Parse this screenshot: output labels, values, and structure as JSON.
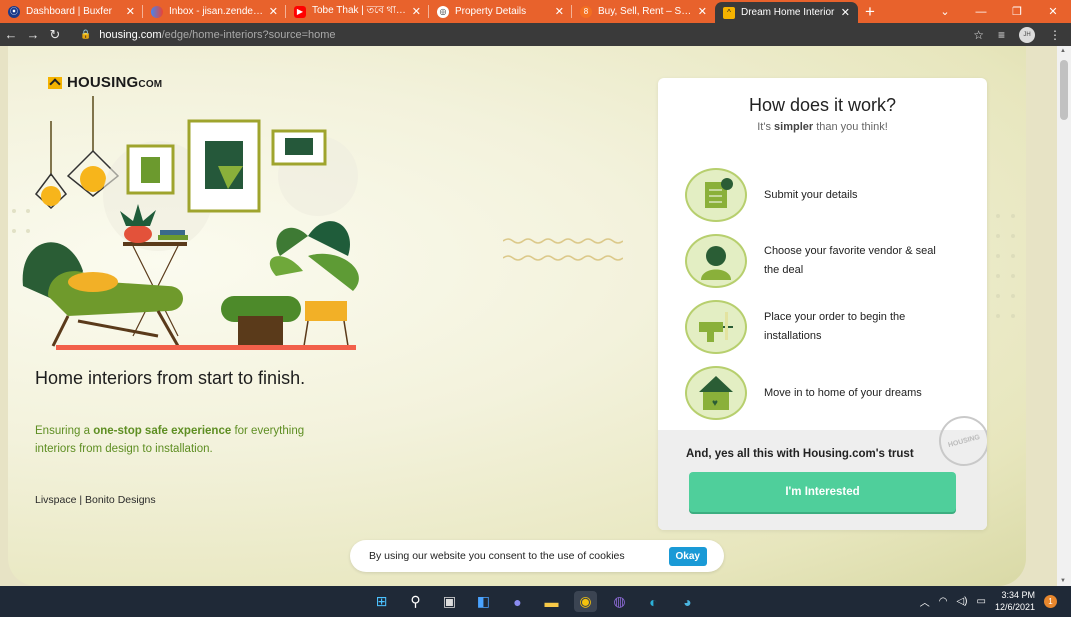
{
  "browser": {
    "tabs": [
      {
        "title": "Dashboard | Buxfer",
        "favicon_color": "#1b3a8a"
      },
      {
        "title": "Inbox - jisan.zendesign",
        "favicon_color": "#8e44ad"
      },
      {
        "title": "Tobe Thak | তবে থাক |",
        "favicon_color": "#ff0000"
      },
      {
        "title": "Property Details",
        "favicon_color": "#2c2c2c"
      },
      {
        "title": "Buy, Sell, Rent – SG Co",
        "favicon_color": "#f36f21"
      },
      {
        "title": "Dream Home Interior",
        "favicon_color": "#f5b300"
      }
    ],
    "new_tab_label": "+",
    "url_host": "housing.com",
    "url_path": "/edge/home-interiors?source=home",
    "profile_label": "JH"
  },
  "page": {
    "logo_word": "HOUSING",
    "logo_suffix": "COM",
    "hero_title": "Home interiors from start to finish.",
    "hero_sub_pre": "Ensuring a ",
    "hero_sub_bold": "one-stop safe experience",
    "hero_sub_post": " for everything interiors from design to installation.",
    "partners": "Livspace | Bonito Designs",
    "card": {
      "title": "How does it work?",
      "tag_pre": "It's ",
      "tag_bold": "simpler",
      "tag_post": " than you think!",
      "steps": [
        {
          "text": "Submit your details",
          "icon": "form-icon"
        },
        {
          "text": "Choose your favorite vendor & seal the deal",
          "icon": "vendor-icon"
        },
        {
          "text": "Place your order to begin the installations",
          "icon": "drill-icon"
        },
        {
          "text": "Move in to home of your dreams",
          "icon": "home-icon"
        }
      ],
      "trust": "And, yes all this with Housing.com's trust",
      "button": "I'm Interested",
      "stamp_text": "HOUSING"
    },
    "cookie": {
      "message": "By using our website you consent to the use of cookies",
      "button": "Okay"
    }
  },
  "taskbar": {
    "time": "3:34 PM",
    "date": "12/6/2021",
    "notifications": "1"
  }
}
